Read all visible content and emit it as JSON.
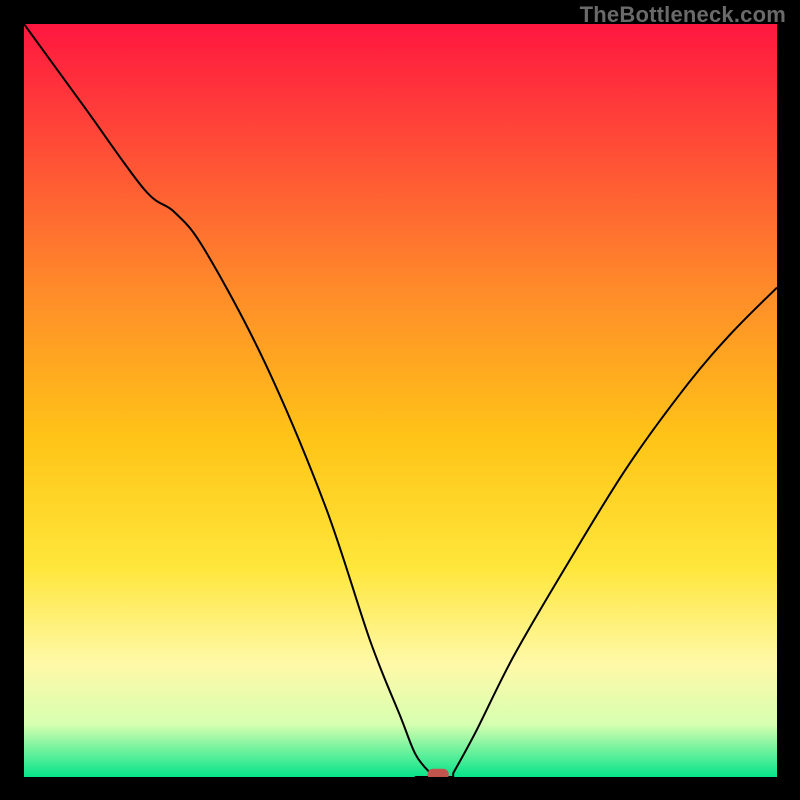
{
  "watermark": "TheBottleneck.com",
  "colors": {
    "gradient": [
      {
        "offset": "0%",
        "color": "#ff173f"
      },
      {
        "offset": "12%",
        "color": "#ff3e3a"
      },
      {
        "offset": "35%",
        "color": "#ff8a2a"
      },
      {
        "offset": "55%",
        "color": "#ffc417"
      },
      {
        "offset": "72%",
        "color": "#ffe63a"
      },
      {
        "offset": "85%",
        "color": "#fff9a8"
      },
      {
        "offset": "93%",
        "color": "#d7ffb0"
      },
      {
        "offset": "100%",
        "color": "#05e48a"
      }
    ],
    "curve": "#000000",
    "marker": "#c1554d",
    "frame": "#000000"
  },
  "chart_data": {
    "type": "line",
    "title": "",
    "xlabel": "",
    "ylabel": "",
    "xlim": [
      0,
      100
    ],
    "ylim": [
      0,
      100
    ],
    "optimum_x": 55,
    "left_branch": {
      "x": [
        0,
        8,
        16,
        20,
        24,
        32,
        40,
        46,
        50,
        52,
        54,
        55
      ],
      "mismatch": [
        100,
        89,
        78,
        75,
        70,
        55,
        36,
        18,
        8,
        3,
        0.5,
        0
      ]
    },
    "right_branch": {
      "x": [
        57,
        60,
        65,
        72,
        80,
        88,
        94,
        100
      ],
      "mismatch": [
        0.5,
        6,
        16,
        28,
        41,
        52,
        59,
        65
      ]
    },
    "flat_segment": {
      "x": [
        52,
        57
      ],
      "mismatch": 0
    },
    "marker": {
      "x": 55,
      "mismatch": 0
    }
  }
}
